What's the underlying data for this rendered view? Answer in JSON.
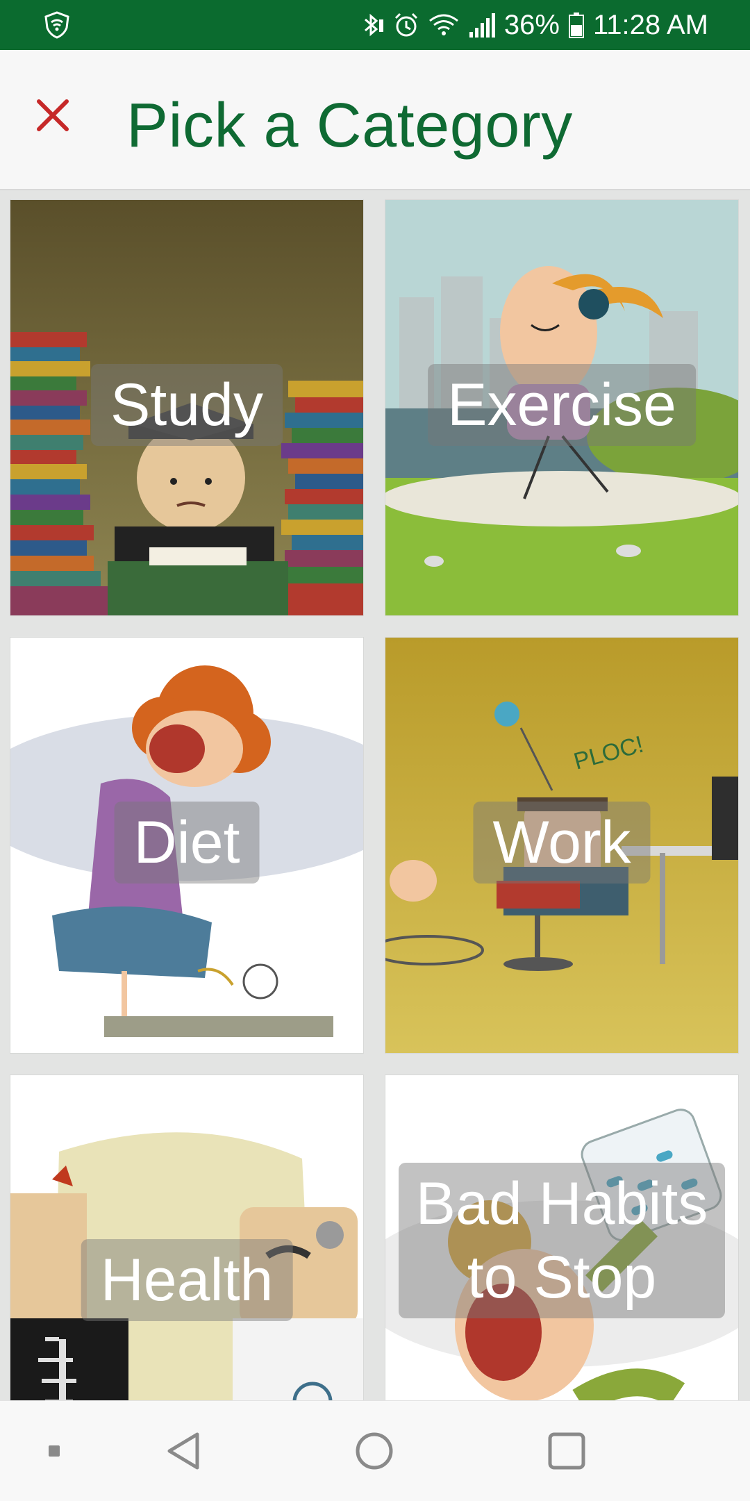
{
  "status_bar": {
    "battery_percent": "36%",
    "time": "11:28 AM",
    "icons": [
      "shield-icon",
      "bluetooth-icon",
      "alarm-icon",
      "wifi-icon",
      "signal-icon",
      "battery-icon"
    ]
  },
  "header": {
    "close_icon": "close-icon",
    "title": "Pick a Category"
  },
  "categories": [
    {
      "label": "Study"
    },
    {
      "label": "Exercise"
    },
    {
      "label": "Diet"
    },
    {
      "label": "Work"
    },
    {
      "label": "Health"
    },
    {
      "label": "Bad Habits to Stop"
    }
  ],
  "nav_bar": {
    "buttons": [
      "recent-dot-icon",
      "back-icon",
      "home-icon",
      "overview-icon"
    ]
  },
  "colors": {
    "status_bar": "#0b6b2f",
    "title": "#0f6a33",
    "close": "#c62828"
  }
}
